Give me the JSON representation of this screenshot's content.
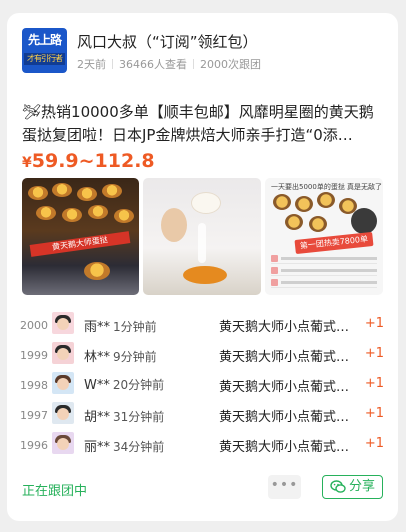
{
  "header": {
    "logo_text_main": "先上路",
    "logo_text_sub": "才有引行者",
    "author": "风口大叔（“订阅”领红包）",
    "time": "2天前",
    "views": "36466人查看",
    "follows": "2000次跟团"
  },
  "post": {
    "title": "🛩热销10000多单【顺丰包邮】风靡明星圈的黄天鹅蛋挞复团啦！日本JP金牌烘焙大师亲手打造“0添…",
    "price_currency": "¥",
    "price": "59.9~112.8",
    "image1_banner": "黄天鹅大师蛋挞",
    "image3_header": "一天要出5000单的蛋挞 真是无敌了",
    "image3_tag": "第一团热卖7800单"
  },
  "orders": [
    {
      "num": "2000",
      "name": "雨**",
      "ago": "1分钟前",
      "product": "黄天鹅大师小点葡式蛋挞",
      "qty": "+1",
      "avatar_bg": "#f7d7dd"
    },
    {
      "num": "1999",
      "name": "林**",
      "ago": "9分钟前",
      "product": "黄天鹅大师小点葡式蛋挞",
      "qty": "+1",
      "avatar_bg": "#f5d2d6"
    },
    {
      "num": "1998",
      "name": "W**",
      "ago": "20分钟前",
      "product": "黄天鹅大师小点葡式蛋挞",
      "qty": "+1",
      "avatar_bg": "#d4e6f5"
    },
    {
      "num": "1997",
      "name": "胡**",
      "ago": "31分钟前",
      "product": "黄天鹅大师小点葡式蛋挞",
      "qty": "+1",
      "avatar_bg": "#dfe8f0"
    },
    {
      "num": "1996",
      "name": "丽**",
      "ago": "34分钟前",
      "product": "黄天鹅大师小点葡式蛋挞",
      "qty": "+1",
      "avatar_bg": "#e8d8f0"
    }
  ],
  "footer": {
    "status": "正在跟团中",
    "more": "•••",
    "share": "分享"
  },
  "colors": {
    "accent_price": "#ee5a24",
    "accent_green": "#27b15b"
  }
}
